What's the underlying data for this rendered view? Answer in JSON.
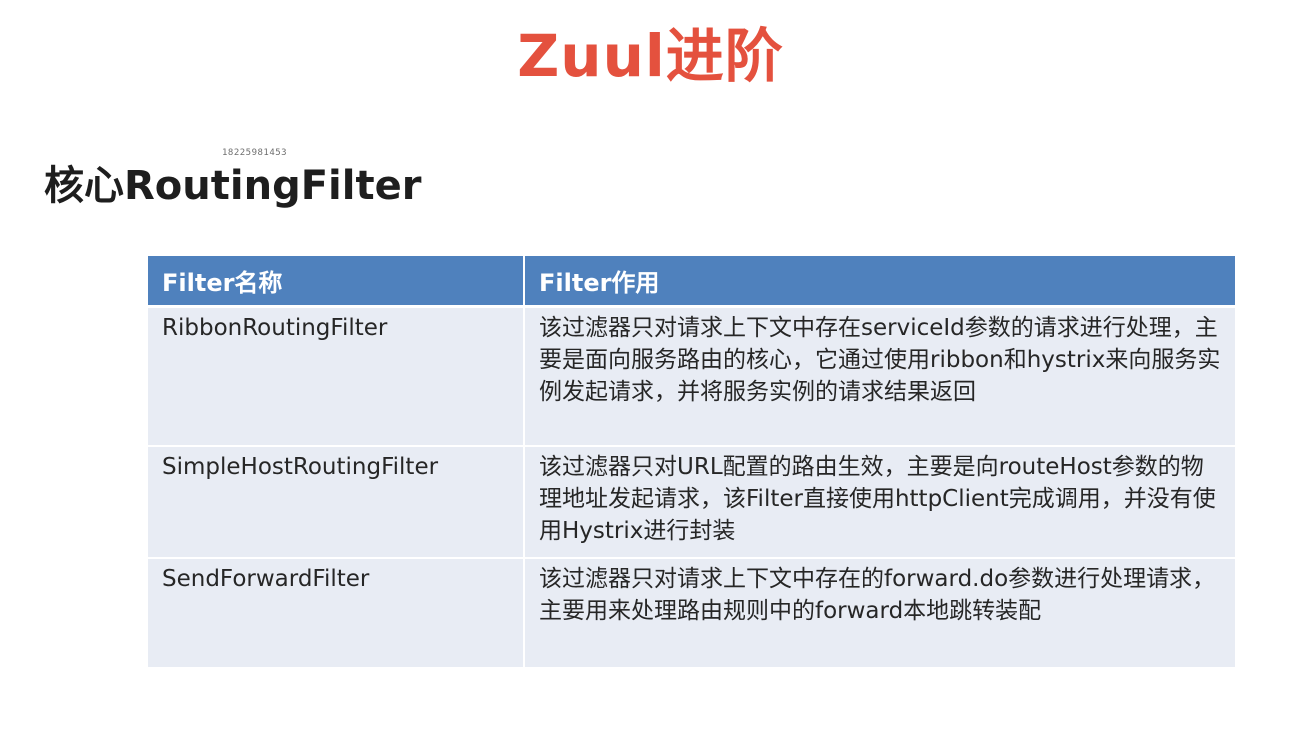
{
  "slide": {
    "title": "Zuul进阶",
    "watermark": "18225981453",
    "heading": "核心RoutingFilter"
  },
  "table": {
    "headers": [
      "Filter名称",
      "Filter作用"
    ],
    "rows": [
      {
        "name": "RibbonRoutingFilter",
        "description": "该过滤器只对请求上下文中存在serviceId参数的请求进行处理，主要是面向服务路由的核心，它通过使用ribbon和hystrix来向服务实例发起请求，并将服务实例的请求结果返回"
      },
      {
        "name": "SimpleHostRoutingFilter",
        "description": "该过滤器只对URL配置的路由生效，主要是向routeHost参数的物理地址发起请求，该Filter直接使用httpClient完成调用，并没有使用Hystrix进行封装"
      },
      {
        "name": "SendForwardFilter",
        "description": "该过滤器只对请求上下文中存在的forward.do参数进行处理请求，主要用来处理路由规则中的forward本地跳转装配"
      }
    ]
  },
  "colors": {
    "title": "#e4513e",
    "header_bg": "#4f81bd",
    "row_bg": "#e8ecf4"
  }
}
